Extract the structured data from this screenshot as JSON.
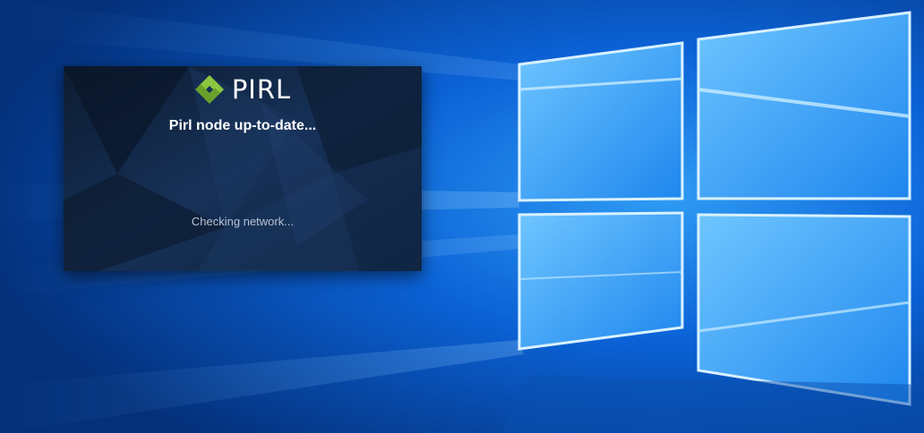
{
  "splash": {
    "app_name": "PIRL",
    "title": "Pirl node up-to-date...",
    "status": "Checking network...",
    "logo_icon": "pirl-logo-icon",
    "logo_color": "#8cc63f"
  },
  "desktop": {
    "wallpaper": "windows-10-hero-wallpaper",
    "accent": "#0b62d6"
  }
}
